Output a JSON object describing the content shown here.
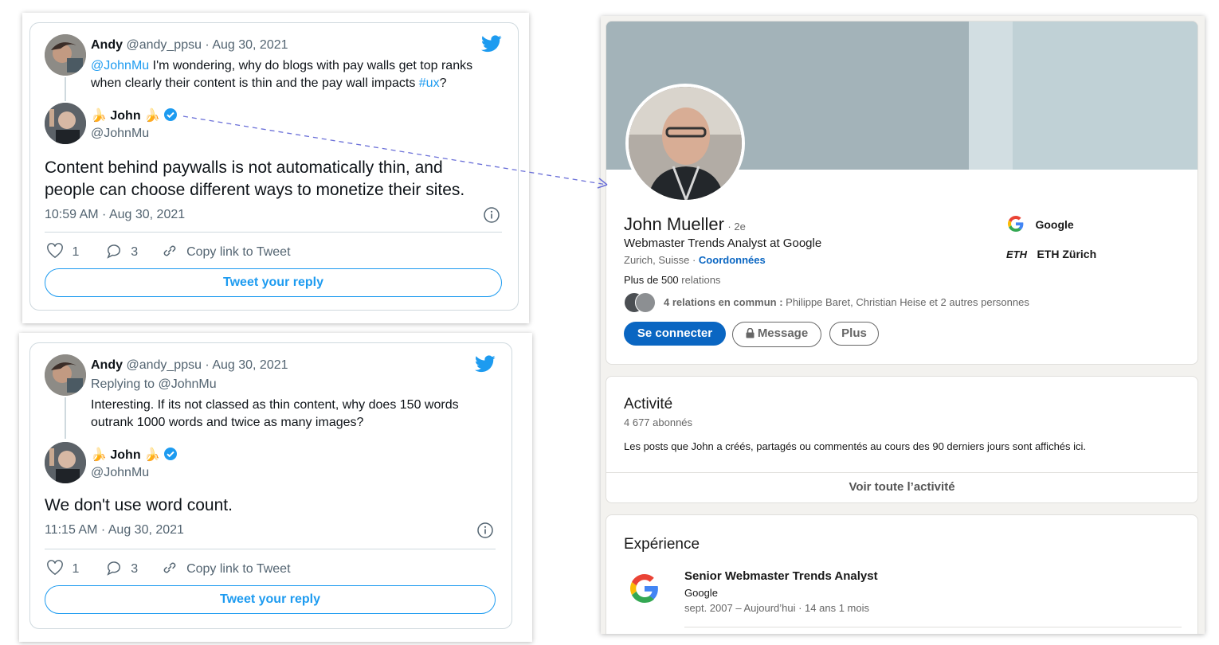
{
  "tweet1": {
    "author_name": "Andy",
    "author_meta": "@andy_ppsu · Aug 30, 2021",
    "mention": "@JohnMu",
    "text_a": " I'm wondering, why do blogs with pay walls get top ranks",
    "text_b": "when clearly  their content is thin and the pay wall impacts ",
    "hashtag": "#ux",
    "text_c": "?",
    "reply_name": "John",
    "reply_handle": "@JohnMu",
    "reply_text_1": "Content behind paywalls is not automatically thin, and",
    "reply_text_2": "people can choose different ways to monetize their sites.",
    "timestamp": "10:59 AM · Aug 30, 2021",
    "likes": "1",
    "replies": "3",
    "copy_link": "Copy link to Tweet",
    "reply_button": "Tweet your reply"
  },
  "tweet2": {
    "author_name": "Andy",
    "author_meta": "@andy_ppsu · Aug 30, 2021",
    "replying_to": "Replying to @JohnMu",
    "text_1": "Interesting. If its not classed as thin content, why does 150 words",
    "text_2": "outrank 1000 words and twice as many images?",
    "reply_name": "John",
    "reply_handle": "@JohnMu",
    "reply_text": "We don't use word count.",
    "timestamp": "11:15 AM · Aug 30, 2021",
    "likes": "1",
    "replies": "3",
    "copy_link": "Copy link to Tweet",
    "reply_button": "Tweet your reply"
  },
  "linkedin": {
    "name": "John Mueller",
    "degree": "· 2e",
    "headline": "Webmaster Trends Analyst at Google",
    "location": "Zurich, Suisse · ",
    "contact_link": "Coordonnées",
    "connections_bold": "Plus de 500",
    "connections_rest": " relations",
    "mutual_bold": "4 relations en commun :",
    "mutual_rest": " Philippe Baret, Christian Heise et 2 autres personnes",
    "companies": [
      {
        "logo": "G",
        "name": "Google"
      },
      {
        "logo": "ETH",
        "name": "ETH Zürich"
      }
    ],
    "buttons": {
      "connect": "Se connecter",
      "message": "Message",
      "more": "Plus"
    },
    "activity": {
      "title": "Activité",
      "followers": "4 677 abonnés",
      "description": "Les posts que John a créés, partagés ou commentés au cours des 90 derniers jours sont affichés ici.",
      "see_all": "Voir toute l’activité"
    },
    "experience": {
      "title": "Expérience",
      "role": "Senior Webmaster Trends Analyst",
      "company": "Google",
      "dates": "sept. 2007 – Aujourd’hui · 14 ans 1 mois"
    }
  },
  "colors": {
    "twitter_blue": "#1d9bf0",
    "linkedin_blue": "#0a66c2",
    "arrow": "#6a6fd8",
    "banner": "#a3b3b9"
  },
  "icons": [
    "twitter-bird-icon",
    "verified-badge-icon",
    "banana-icon",
    "heart-icon",
    "reply-bubble-icon",
    "link-icon",
    "info-icon",
    "lock-icon",
    "google-logo-icon"
  ]
}
